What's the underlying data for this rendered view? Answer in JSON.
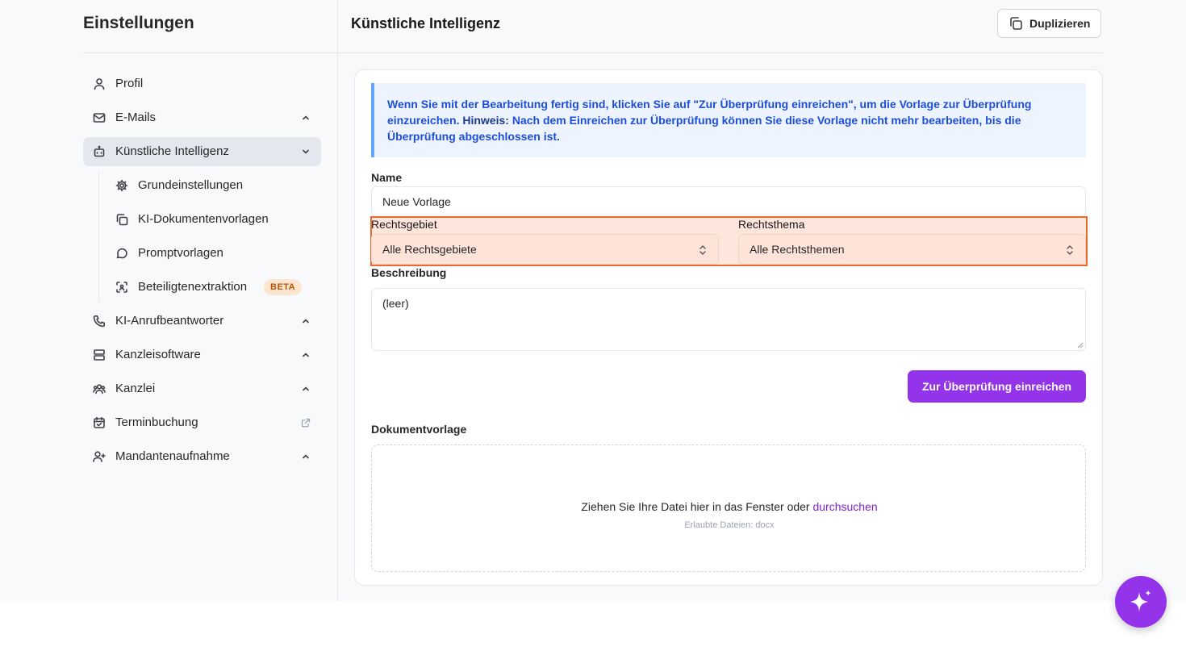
{
  "sidebar": {
    "title": "Einstellungen",
    "items": [
      {
        "label": "Profil",
        "icon": "user-icon"
      },
      {
        "label": "E-Mails",
        "icon": "mail-icon"
      },
      {
        "label": "Künstliche Intelligenz",
        "icon": "bot-icon"
      },
      {
        "label": "KI-Anrufbeantworter",
        "icon": "phone-icon"
      },
      {
        "label": "Kanzleisoftware",
        "icon": "server-icon"
      },
      {
        "label": "Kanzlei",
        "icon": "users-icon"
      },
      {
        "label": "Terminbuchung",
        "icon": "calendar-icon"
      },
      {
        "label": "Mandantenaufnahme",
        "icon": "user-plus-icon"
      }
    ],
    "sub_items": [
      {
        "label": "Grundeinstellungen",
        "icon": "gear-icon"
      },
      {
        "label": "KI-Dokumentenvorlagen",
        "icon": "copy-icon"
      },
      {
        "label": "Promptvorlagen",
        "icon": "chat-bubble-icon"
      },
      {
        "label": "Beteiligtenextraktion",
        "icon": "scan-icon",
        "badge": "BETA"
      }
    ]
  },
  "header": {
    "title": "Künstliche Intelligenz",
    "duplicate_label": "Duplizieren"
  },
  "info": {
    "text_before": "Wenn Sie mit der Bearbeitung fertig sind, klicken Sie auf \"Zur Überprüfung einreichen\", um die Vorlage zur Überprüfung einzureichen. ",
    "hint_label": "Hinweis:",
    "text_after": " Nach dem Einreichen zur Überprüfung können Sie diese Vorlage nicht mehr bearbeiten, bis die Überprüfung abgeschlossen ist."
  },
  "form": {
    "name_label": "Name",
    "name_value": "Neue Vorlage",
    "rechtsgebiet_label": "Rechtsgebiet",
    "rechtsgebiet_value": "Alle Rechtsgebiete",
    "rechtsthema_label": "Rechtsthema",
    "rechtsthema_value": "Alle Rechtsthemen",
    "beschreibung_label": "Beschreibung",
    "beschreibung_value": "(leer)",
    "submit_label": "Zur Überprüfung einreichen",
    "dokumentvorlage_label": "Dokumentvorlage",
    "dropzone_text": "Ziehen Sie Ihre Datei hier in das Fenster oder ",
    "dropzone_link": "durchsuchen",
    "dropzone_sub": "Erlaubte Dateien: docx"
  },
  "colors": {
    "accent": "#9333ea",
    "info_text": "#1d4ed8",
    "highlight_border": "#e86a2c"
  }
}
